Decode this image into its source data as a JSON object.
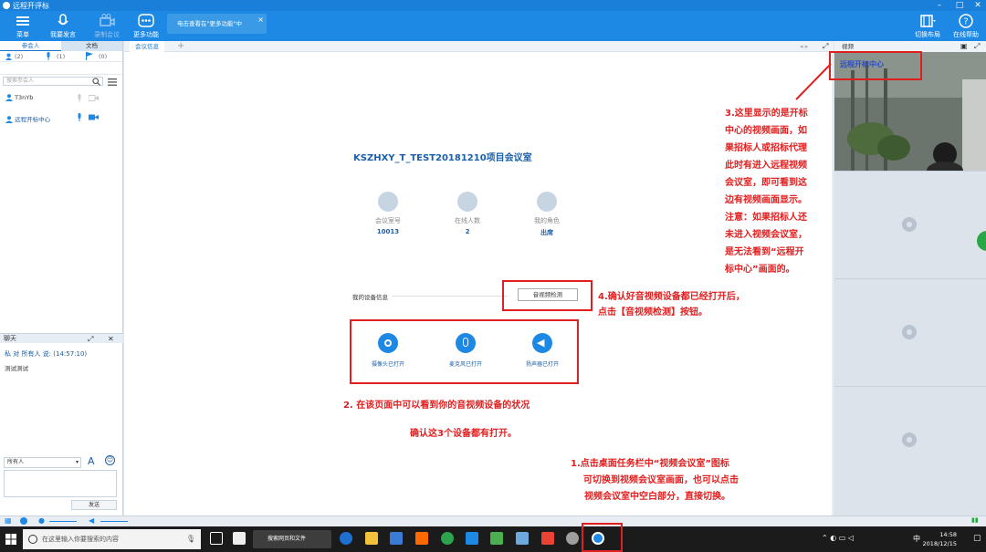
{
  "window": {
    "title": "远程开评标"
  },
  "toolbar": {
    "menu": "菜单",
    "speak": "我要发言",
    "record": "录制会议",
    "more": "更多功能",
    "tooltip": "电击查看在\"更多功能\"中",
    "switch_layout": "切换布局",
    "online_help": "在线帮助"
  },
  "left": {
    "tab_participants": "参会人",
    "tab_docs": "文档",
    "count_people": "(2)",
    "count_mic": "(1)",
    "count_flag": "(0)",
    "search_placeholder": "搜索参会人",
    "members": [
      "T3nYb",
      "远程开标中心"
    ],
    "chat_title": "聊天",
    "chat_to": "私  对  所有人  说: (14:57:10)",
    "chat_text": "测试测试",
    "send_target": "所有人",
    "send_label": "发送"
  },
  "center": {
    "tab": "会议信息",
    "room_title": "KSZHXY_T_TEST20181210项目会议室",
    "stats": [
      {
        "label": "会议室号",
        "value": "10013"
      },
      {
        "label": "在线人数",
        "value": "2"
      },
      {
        "label": "我的角色",
        "value": "出席"
      }
    ],
    "device_label": "我的设备信息",
    "device_button": "音视频检测",
    "devices": [
      "摄像头已打开",
      "麦克风已打开",
      "扬声器已打开"
    ]
  },
  "notes": {
    "n2a": "2.    在该页面中可以看到你的音视频设备的状况",
    "n2b": "确认这3个设备都有打开。",
    "n3": [
      "3.这里显示的是开标",
      "中心的视频画面，如",
      "果招标人或招标代理",
      "此时有进入远程视频",
      "会议室，即可看到这",
      "边有视频画面显示。",
      "注意：如果招标人还",
      "未进入视频会议室，",
      "是无法看到“远程开",
      "标中心”画面的。"
    ],
    "n4a": "4.确认好音视频设备都已经打开后，",
    "n4b": "点击【音视频检测】按钮。",
    "n1": [
      "1.点击桌面任务栏中“视频会议室”图标",
      "可切换到视频会议室画面，也可以点击",
      "视频会议室中空白部分，直接切换。"
    ]
  },
  "right": {
    "header": "视频",
    "video_caption": "远程开标中心"
  },
  "taskbar": {
    "search": "在这里输入你要搜索的内容",
    "browser_tab": "搜索网页和文件",
    "time": "14:58",
    "date": "2018/12/15",
    "ime": "中"
  }
}
